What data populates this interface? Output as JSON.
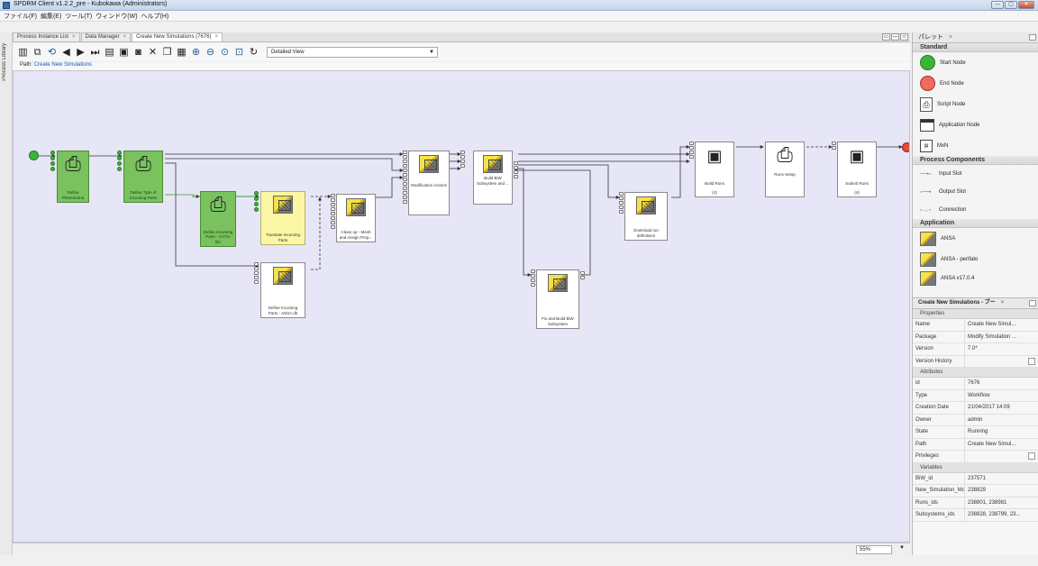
{
  "window": {
    "title": "SPDRM Client v1.2.2_pre - Kubokawa (Administrators)",
    "controls": [
      "—",
      "▢",
      "✕"
    ]
  },
  "menu": [
    "ファイル(F)",
    "編集(E)",
    "ツール(T)",
    "ウィンドウ(W)",
    "ヘルプ(H)"
  ],
  "side": {
    "label": "Process Library"
  },
  "tabs": [
    {
      "label": "Process Instance List"
    },
    {
      "label": "Data Manager"
    },
    {
      "label": "Create New Simulations (7676)"
    }
  ],
  "toolbar": {
    "view_select": "Detailed View",
    "icons": [
      "library-icon",
      "copy-icon",
      "refresh-icon",
      "back-icon",
      "forward-icon",
      "step-icon",
      "save-icon",
      "save-as-icon",
      "camera-icon",
      "delete-icon",
      "copy-node-icon",
      "paste-icon",
      "zoom-in-icon",
      "zoom-out-icon",
      "zoom-fit-icon",
      "zoom-area-icon",
      "redo-icon"
    ]
  },
  "path": {
    "label": "Path:",
    "value": "Create New Simulations"
  },
  "canvas": {
    "background": "#e6e6f7"
  },
  "nodes": {
    "n1": "Define Phenomena",
    "n2": "Define Type of Incoming Parts",
    "n3": "Define Incoming Parts - CATIA file",
    "n4": "Translate Incoming Parts",
    "n5": "Define Incoming Parts - ANSA db",
    "n6": "Clean up - Mesh and Assign Prop...",
    "n7": "Modification Actions",
    "n8": "Build BiW Subsystem and ...",
    "n9": "Fix and Build BiW Subsystem",
    "n10": "Download run definitions",
    "n11": "Build Runs",
    "n11b": "(4)",
    "n12": "Runs Setup",
    "n13": "Submit Runs",
    "n13b": "(4)"
  },
  "status": {
    "zoom": "55%"
  },
  "palette": {
    "title": "パレット",
    "standard": {
      "header": "Standard",
      "items": [
        "Start Node",
        "End Node",
        "Script Node",
        "Application Node",
        "MxN"
      ]
    },
    "process_components": {
      "header": "Process Components",
      "items": [
        "Input Slot",
        "Output Slot",
        "Connection"
      ]
    },
    "application": {
      "header": "Application",
      "items": [
        "ANSA",
        "ANSA - perifato",
        "ANSA v17.0.4"
      ]
    }
  },
  "properties": {
    "title": "Create New Simulations - ブー",
    "sections": {
      "properties": "Properties",
      "attributes": "Attributes",
      "variables": "Variables"
    },
    "rows_properties": [
      {
        "k": "Name",
        "v": "Create New Simul..."
      },
      {
        "k": "Package",
        "v": "Modify Simulation ..."
      },
      {
        "k": "Version",
        "v": "7.0*"
      },
      {
        "k": "Version History",
        "v": ""
      }
    ],
    "rows_attributes": [
      {
        "k": "id",
        "v": "7676"
      },
      {
        "k": "Type",
        "v": "Workflow"
      },
      {
        "k": "Creation Date",
        "v": "21/04/2017 14:09"
      },
      {
        "k": "Owner",
        "v": "admin"
      },
      {
        "k": "State",
        "v": "Running"
      },
      {
        "k": "Path",
        "v": "Create New Simul..."
      },
      {
        "k": "Privileges",
        "v": ""
      }
    ],
    "rows_variables": [
      {
        "k": "BiW_id",
        "v": "237571"
      },
      {
        "k": "New_Simulation_Mod",
        "v": "238829"
      },
      {
        "k": "Runs_ids",
        "v": "238801, 238981"
      },
      {
        "k": "Subsystems_ids",
        "v": "238828, 238799, 23..."
      }
    ]
  }
}
